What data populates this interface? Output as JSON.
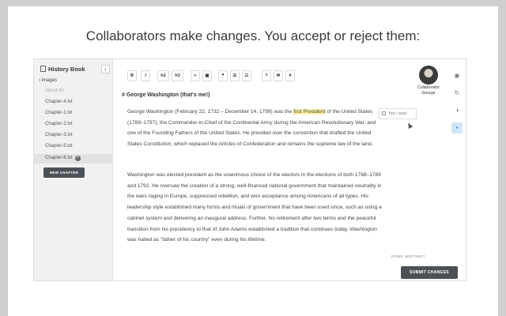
{
  "headline": "Collaborators make changes. You accept or reject them:",
  "sidebar": {
    "title": "History Book",
    "collapse_icon": "‹",
    "folder": "› images",
    "files": [
      {
        "name": "About.txt",
        "muted": true
      },
      {
        "name": "Chapter-4.txt"
      },
      {
        "name": "Chapter-1.txt"
      },
      {
        "name": "Chapter-2.txt"
      },
      {
        "name": "Chapter-3.txt"
      },
      {
        "name": "Chapter-5.txt"
      },
      {
        "name": "Chapter-6.txt",
        "active": true
      }
    ],
    "new_chapter": "NEW CHAPTER"
  },
  "toolbar": {
    "bold": "B",
    "italic": "I",
    "h2": "h2",
    "h3": "h3",
    "link": "∞",
    "image": "▣",
    "quote": "❝",
    "ul": "☰",
    "ol": "☷",
    "help": "?",
    "mail": "✉",
    "hash": "#"
  },
  "doc": {
    "heading": "# George Washington (that's me!)",
    "p1_before": "George Washington (February 22, 1732 – December 14, 1799) was the ",
    "p1_highlight": "first President",
    "p1_after": " of the United States (1789–1797), the Commander-in-Chief of the Continental Army during the American Revolutionary War, and one of the Founding Fathers of the United States. He presided over the convention that drafted the United States Constitution, which replaced the Articles of Confederation and remains the supreme law of the land.",
    "p2": "Washington was elected president as the unanimous choice of the electors in the elections of both 1788–1789 and 1792. He oversaw the creation of a strong, well-financed national government that maintained neutrality in the wars raging in Europe, suppressed rebellion, and won acceptance among Americans of all types. His leadership style established many forms and rituals of government that have been used since, such as using a cabinet system and delivering an inaugural address. Further, his retirement after two terms and the peaceful transition from his presidency to that of John Adams established a tradition that continues today. Washington was hailed as \"father of his country\" even during his lifetime."
  },
  "comment": "Yes I was!",
  "collaborator": {
    "line1": "Collaborator",
    "line2": "George"
  },
  "rail_icons": [
    "eye-icon",
    "history-icon",
    "contrast-icon",
    "chat-icon"
  ],
  "done_writing": "DONE WRITING?",
  "submit": "SUBMIT CHANGES"
}
